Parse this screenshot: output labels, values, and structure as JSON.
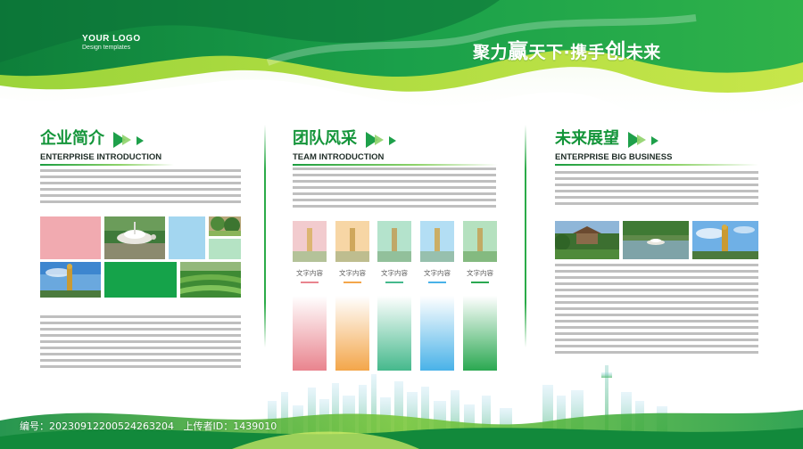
{
  "header": {
    "logo_title": "YOUR LOGO",
    "logo_subtitle": "Design templates",
    "slogan_part1": "聚力",
    "slogan_big1": "赢",
    "slogan_part2": "天下·携手",
    "slogan_big2": "创",
    "slogan_part3": "未来"
  },
  "sections": [
    {
      "title": "企业简介",
      "subtitle": "ENTERPRISE INTRODUCTION"
    },
    {
      "title": "团队风采",
      "subtitle": "TEAM INTRODUCTION"
    },
    {
      "title": "未来展望",
      "subtitle": "ENTERPRISE BIG BUSINESS"
    }
  ],
  "team": {
    "members": [
      {
        "label": "文字内容",
        "color": "#e9848e"
      },
      {
        "label": "文字内容",
        "color": "#f3a64a"
      },
      {
        "label": "文字内容",
        "color": "#45b98c"
      },
      {
        "label": "文字内容",
        "color": "#49b2e8"
      },
      {
        "label": "文字内容",
        "color": "#2aa851"
      }
    ]
  },
  "colors": {
    "brand_green": "#14953a",
    "light_green": "#8fd36a",
    "pink": "#f1aab0",
    "sky": "#a3d6f0",
    "mint": "#b5e3c4",
    "grass": "#15a34a"
  },
  "watermark": {
    "id_label": "编号：",
    "id_value": "20230912200524263204",
    "uploader_label": "上传者ID：",
    "uploader_value": "1439010"
  }
}
